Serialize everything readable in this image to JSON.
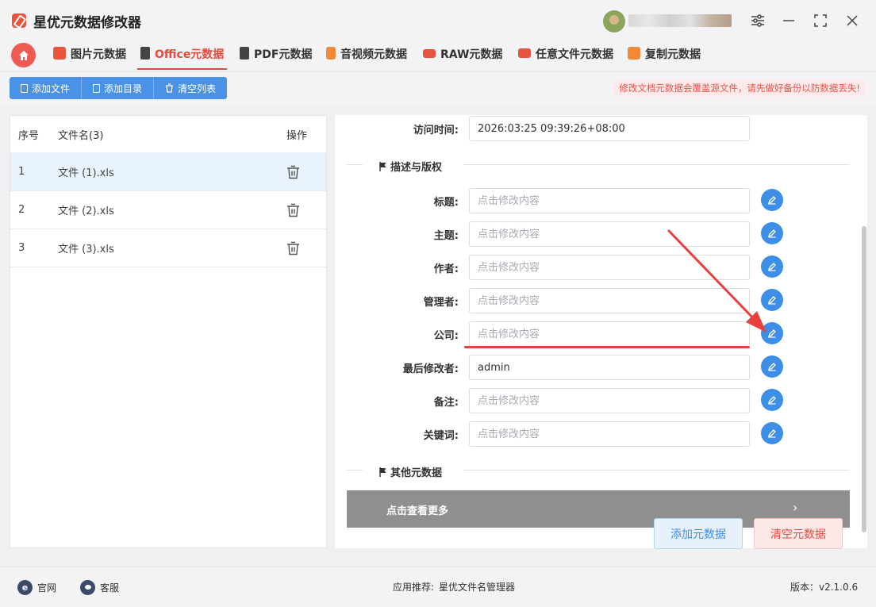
{
  "app": {
    "title": "星优元数据修改器"
  },
  "tabs": [
    {
      "label": "图片元数据",
      "icon": "image-icon",
      "color": "#e8553f"
    },
    {
      "label": "Office元数据",
      "icon": "office-icon",
      "color": "#e8553f",
      "active": true
    },
    {
      "label": "PDF元数据",
      "icon": "pdf-icon",
      "color": "#d33"
    },
    {
      "label": "音视频元数据",
      "icon": "media-icon",
      "color": "#e8553f"
    },
    {
      "label": "RAW元数据",
      "icon": "raw-icon",
      "color": "#e8553f"
    },
    {
      "label": "任意文件元数据",
      "icon": "file-icon",
      "color": "#e8553f"
    },
    {
      "label": "复制元数据",
      "icon": "copy-icon",
      "color": "#e8553f"
    }
  ],
  "toolbar": {
    "add_file": "添加文件",
    "add_folder": "添加目录",
    "clear_list": "清空列表",
    "warning": "修改文档元数据会覆盖源文件，请先做好备份以防数据丢失!"
  },
  "file_list": {
    "headers": {
      "index": "序号",
      "name": "文件名(3)",
      "action": "操作"
    },
    "rows": [
      {
        "index": "1",
        "name": "文件 (1).xls"
      },
      {
        "index": "2",
        "name": "文件 (2).xls"
      },
      {
        "index": "3",
        "name": "文件 (3).xls"
      }
    ]
  },
  "form": {
    "access_time": {
      "label": "访问时间:",
      "value": "2026:03:25 09:39:26+08:00"
    },
    "section_desc": "描述与版权",
    "placeholder": "点击修改内容",
    "fields": [
      {
        "label": "标题:",
        "value": ""
      },
      {
        "label": "主题:",
        "value": ""
      },
      {
        "label": "作者:",
        "value": ""
      },
      {
        "label": "管理者:",
        "value": ""
      },
      {
        "label": "公司:",
        "value": ""
      },
      {
        "label": "最后修改者:",
        "value": "admin"
      },
      {
        "label": "备注:",
        "value": ""
      },
      {
        "label": "关键词:",
        "value": ""
      }
    ],
    "section_other": "其他元数据",
    "more": "点击查看更多",
    "more_chevron": "›",
    "add_meta": "添加元数据",
    "clear_meta": "清空元数据"
  },
  "footer": {
    "website": "官网",
    "support": "客服",
    "recommend_label": "应用推荐:",
    "recommend_app": "星优文件名管理器",
    "version": "版本：v2.1.0.6"
  },
  "colors": {
    "accent_red": "#e8493c",
    "primary_blue": "#4a92e8",
    "annotation_red": "#e8403f"
  }
}
